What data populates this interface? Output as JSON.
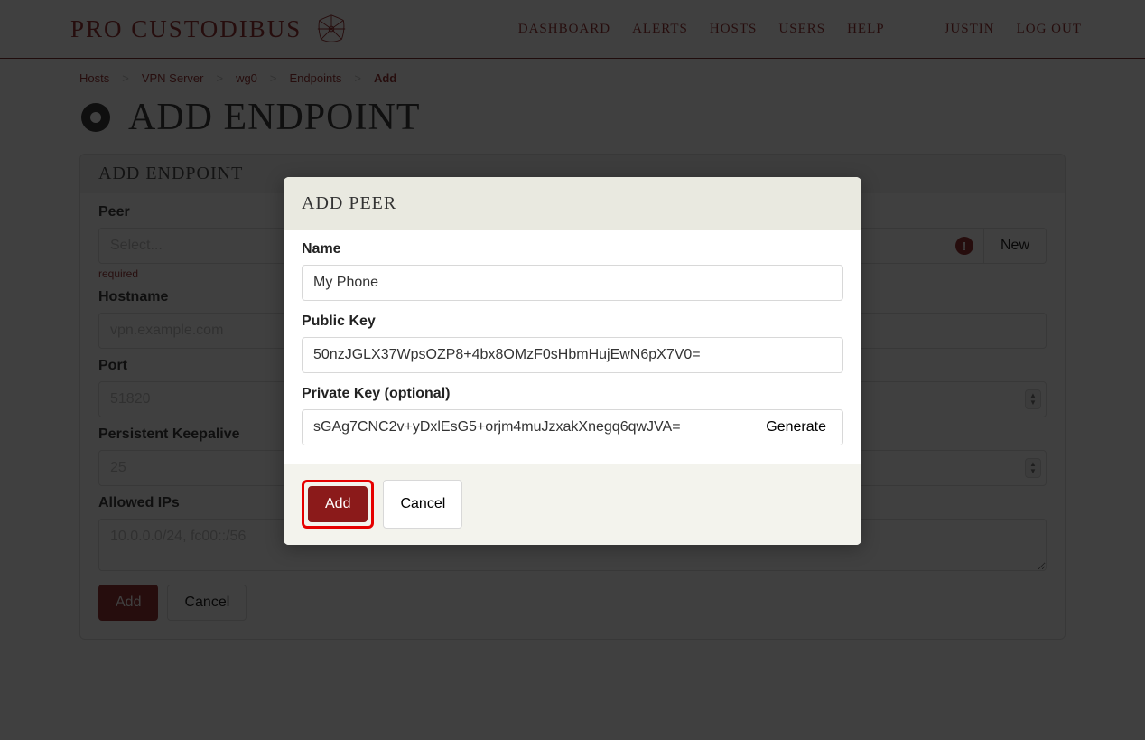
{
  "brand": "PRO CUSTODIBUS",
  "nav": {
    "dashboard": "DASHBOARD",
    "alerts": "ALERTS",
    "hosts": "HOSTS",
    "users": "USERS",
    "help": "HELP",
    "user": "JUSTIN",
    "logout": "LOG OUT"
  },
  "breadcrumb": {
    "hosts": "Hosts",
    "vpnserver": "VPN Server",
    "wg0": "wg0",
    "endpoints": "Endpoints",
    "add": "Add"
  },
  "page_title": "ADD ENDPOINT",
  "panel": {
    "title": "ADD ENDPOINT",
    "peer_label": "Peer",
    "peer_placeholder": "Select...",
    "peer_required": "required",
    "new_btn": "New",
    "hostname_label": "Hostname",
    "hostname_placeholder": "vpn.example.com",
    "port_label": "Port",
    "port_placeholder": "51820",
    "keepalive_label": "Persistent Keepalive",
    "keepalive_placeholder": "25",
    "allowed_label": "Allowed IPs",
    "allowed_placeholder": "10.0.0.0/24, fc00::/56",
    "add_btn": "Add",
    "cancel_btn": "Cancel"
  },
  "modal": {
    "title": "ADD PEER",
    "name_label": "Name",
    "name_value": "My Phone",
    "pubkey_label": "Public Key",
    "pubkey_value": "50nzJGLX37WpsOZP8+4bx8OMzF0sHbmHujEwN6pX7V0=",
    "privkey_label": "Private Key (optional)",
    "privkey_value": "sGAg7CNC2v+yDxlEsG5+orjm4muJzxakXnegq6qwJVA=",
    "generate_btn": "Generate",
    "add_btn": "Add",
    "cancel_btn": "Cancel"
  }
}
